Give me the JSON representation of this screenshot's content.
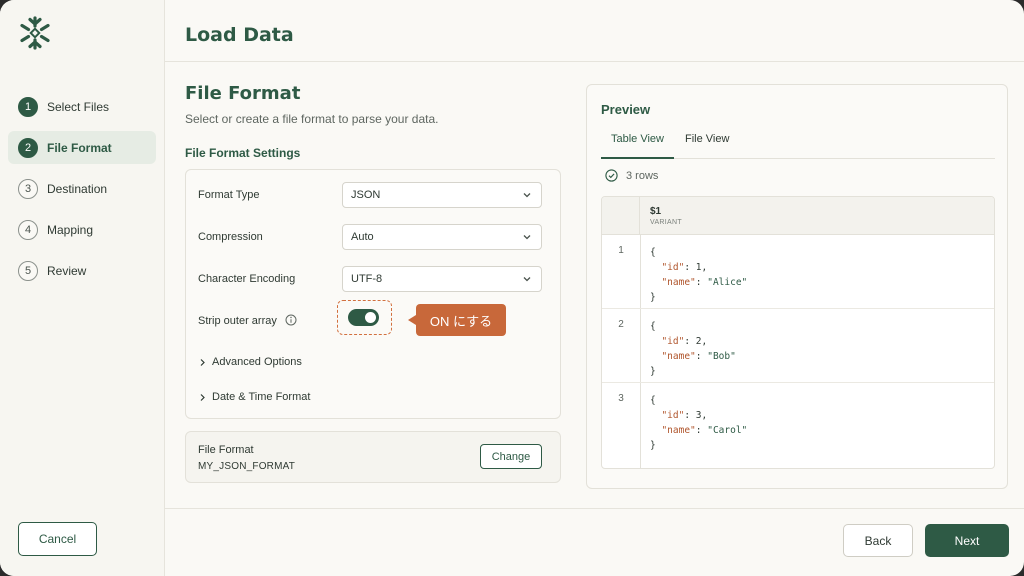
{
  "app": {
    "title": "Load Data"
  },
  "sidebar": {
    "logo_icon": "snowflake-icon",
    "steps": [
      {
        "num": "1",
        "label": "Select Files",
        "state": "done"
      },
      {
        "num": "2",
        "label": "File Format",
        "state": "active"
      },
      {
        "num": "3",
        "label": "Destination",
        "state": "pending"
      },
      {
        "num": "4",
        "label": "Mapping",
        "state": "pending"
      },
      {
        "num": "5",
        "label": "Review",
        "state": "pending"
      }
    ],
    "cancel_label": "Cancel"
  },
  "form": {
    "title": "File Format",
    "subtitle": "Select or create a file format to parse your data.",
    "settings_title": "File Format Settings",
    "format_type": {
      "label": "Format Type",
      "value": "JSON"
    },
    "compression": {
      "label": "Compression",
      "value": "Auto"
    },
    "encoding": {
      "label": "Character Encoding",
      "value": "UTF-8"
    },
    "strip_outer_array": {
      "label": "Strip outer array",
      "on": true
    },
    "callout": "ON にする",
    "advanced_label": "Advanced Options",
    "datetime_label": "Date & Time Format",
    "file_format_card": {
      "label": "File Format",
      "value": "MY_JSON_FORMAT",
      "change_label": "Change"
    }
  },
  "preview": {
    "title": "Preview",
    "tabs": [
      "Table View",
      "File View"
    ],
    "rows_info": "3 rows",
    "column": {
      "name": "$1",
      "type": "VARIANT"
    },
    "rows": [
      {
        "idx": "1",
        "id": "1",
        "name": "\"Alice\""
      },
      {
        "idx": "2",
        "id": "2",
        "name": "\"Bob\""
      },
      {
        "idx": "3",
        "id": "3",
        "name": "\"Carol\""
      }
    ]
  },
  "footer": {
    "back_label": "Back",
    "next_label": "Next"
  },
  "colors": {
    "brand": "#2e5a45",
    "callout": "#c8683a",
    "json_key": "#b0552c"
  }
}
